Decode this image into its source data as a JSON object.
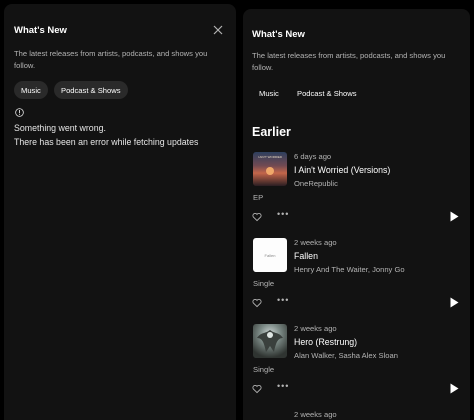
{
  "left_panel": {
    "title": "What's New",
    "subtitle_lines": [
      "The latest releases from artists, podcasts, and shows you",
      "follow."
    ],
    "filters": [
      "Music",
      "Podcast & Shows"
    ],
    "error_title": "Something went wrong.",
    "error_message": "There has been an error while fetching updates"
  },
  "right_panel": {
    "title": "What's New",
    "subtitle_lines": [
      "The latest releases from artists, podcasts, and shows you",
      "follow."
    ],
    "filters": [
      "Music",
      "Podcast & Shows"
    ],
    "section_heading": "Earlier",
    "items": [
      {
        "time": "6 days ago",
        "title": "I Ain't Worried (Versions)",
        "artist": "OneRepublic",
        "type": "EP",
        "art_text": "I AIN'T WORRIED"
      },
      {
        "time": "2 weeks ago",
        "title": "Fallen",
        "artist": "Henry And The Waiter, Jonny Go",
        "type": "Single",
        "art_text": "Fallen"
      },
      {
        "time": "2 weeks ago",
        "title": "Hero (Restrung)",
        "artist": "Alan Walker, Sasha Alex Sloan",
        "type": "Single",
        "art_text": ""
      }
    ],
    "partial_item_time": "2 weeks ago"
  },
  "icons": {
    "close": "close-icon",
    "info": "info-icon",
    "heart": "heart-icon",
    "more": "more-options-icon",
    "play": "play-icon"
  },
  "colors": {
    "panel_bg": "#121212",
    "chip_bg": "#2a2a2a",
    "text_secondary": "#b3b3b3"
  }
}
